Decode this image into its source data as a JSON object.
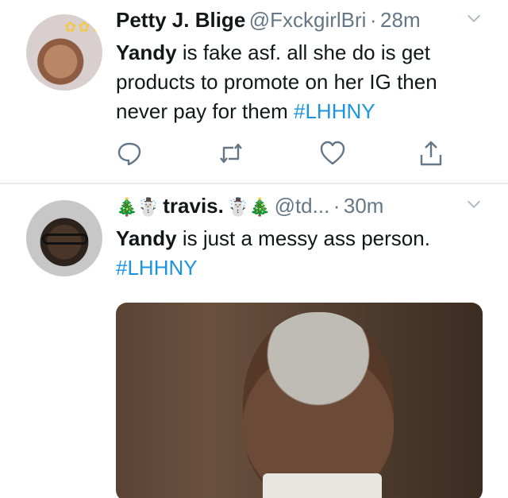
{
  "tweets": [
    {
      "name": "Petty J. Blige",
      "handle": "@FxckgirlBri",
      "separator": "·",
      "time": "28m",
      "text_bold": "Yandy",
      "text_body": " is fake asf.  all she do is get products to promote on her IG then never pay for them ",
      "hashtag": "#LHHNY",
      "actions": [
        "reply-icon",
        "retweet-icon",
        "like-icon",
        "share-icon"
      ]
    },
    {
      "name_prefix": "🎄☃️",
      "name": "travis.",
      "name_suffix": "☃️🎄",
      "handle": "@td...",
      "separator": "·",
      "time": "30m",
      "text_bold": "Yandy",
      "text_body": " is just a messy ass person.",
      "hashtag": "#LHHNY"
    }
  ],
  "colors": {
    "link": "#1b95e0",
    "muted": "#657786",
    "text": "#14171a",
    "divider": "#e6ecf0"
  }
}
